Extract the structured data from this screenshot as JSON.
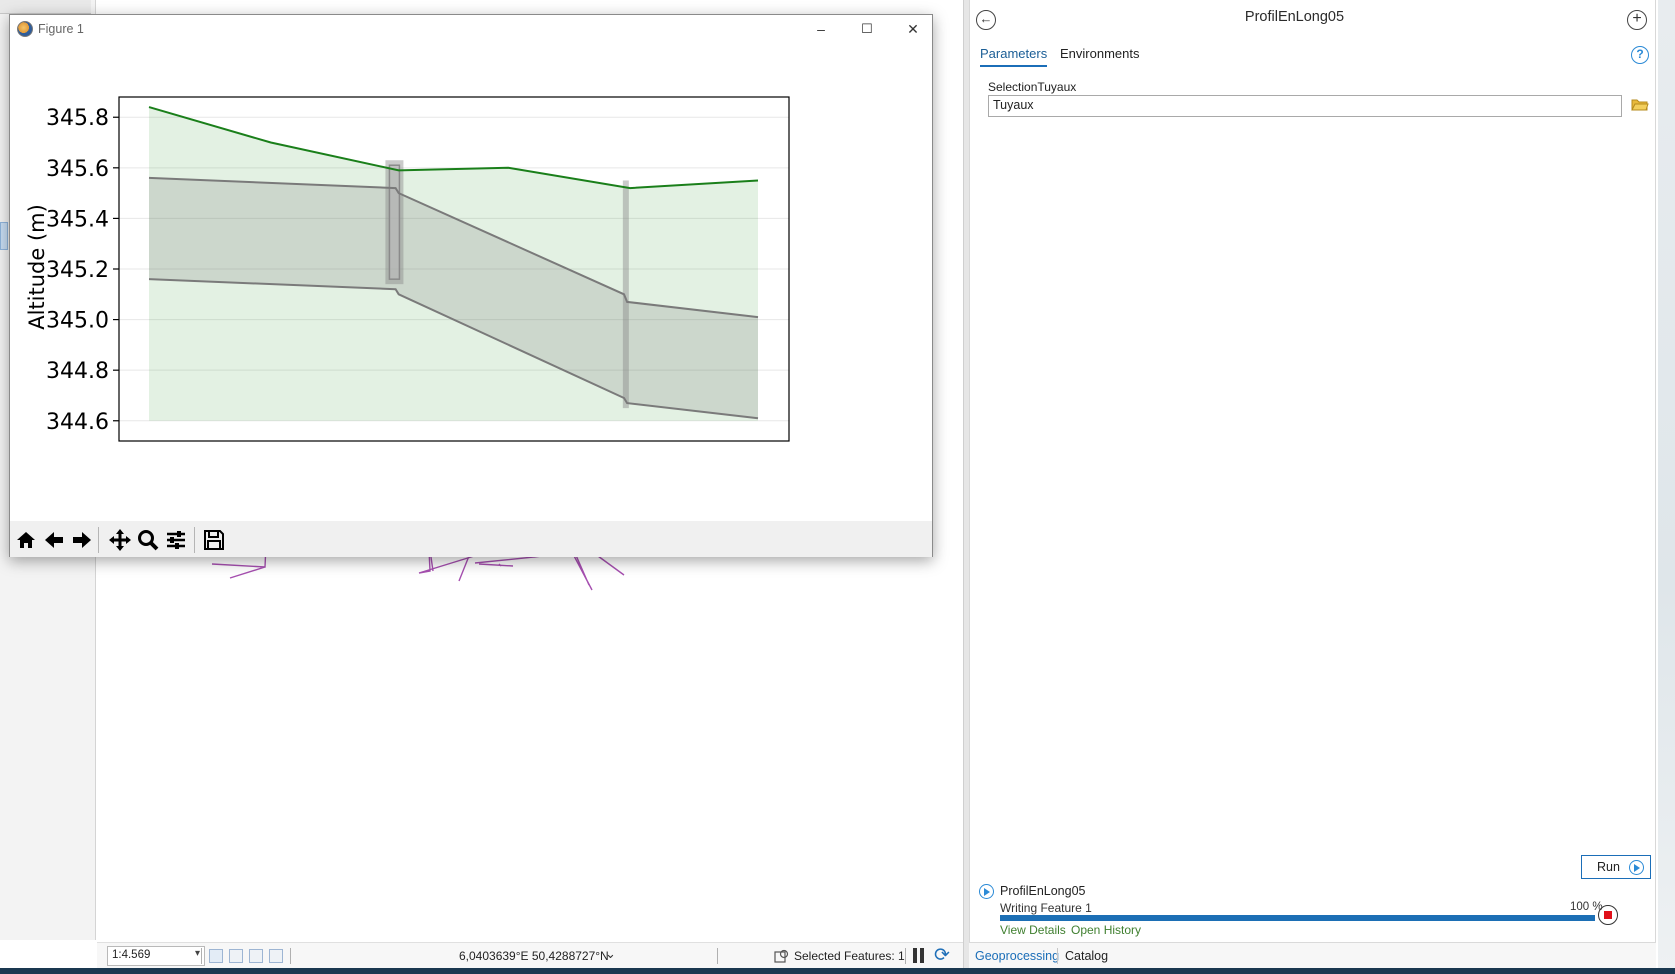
{
  "figure_window": {
    "title": "Figure 1",
    "controls": {
      "minimize": "–",
      "maximize": "☐",
      "close": "✕"
    },
    "toolbar": [
      "home-icon",
      "back-icon",
      "forward-icon",
      "pan-icon",
      "zoom-icon",
      "configure-subplots-icon",
      "save-icon"
    ]
  },
  "chart_data": {
    "type": "area",
    "title": "",
    "xlabel": "",
    "ylabel": "Altitude (m)",
    "x_tick_labels": [],
    "y_ticks": [
      "345.8",
      "345.6",
      "345.4",
      "345.2",
      "345.0",
      "344.8",
      "344.6"
    ],
    "ylim": [
      344.52,
      345.88
    ],
    "grid": true,
    "series": [
      {
        "name": "",
        "kind": "ground-surface",
        "color": "#1a7f1a",
        "points": [
          [
            0,
            345.84
          ],
          [
            0.2,
            345.7
          ],
          [
            0.41,
            345.59
          ],
          [
            0.59,
            345.6
          ],
          [
            0.79,
            345.52
          ],
          [
            1.0,
            345.55
          ]
        ]
      },
      {
        "name": "",
        "kind": "pipe-top",
        "color": "#7a7a7a",
        "points": [
          [
            0,
            345.56
          ],
          [
            0.405,
            345.52
          ],
          [
            0.41,
            345.5
          ],
          [
            0.78,
            345.1
          ],
          [
            0.785,
            345.07
          ],
          [
            1.0,
            345.01
          ]
        ]
      },
      {
        "name": "",
        "kind": "pipe-bottom",
        "color": "#7a7a7a",
        "points": [
          [
            0,
            345.16
          ],
          [
            0.405,
            345.12
          ],
          [
            0.41,
            345.1
          ],
          [
            0.78,
            344.69
          ],
          [
            0.785,
            344.67
          ],
          [
            1.0,
            344.61
          ]
        ]
      }
    ],
    "fill_base": 344.6,
    "manholes": [
      {
        "x": 0.403,
        "top": 345.63,
        "bottom": 345.14
      },
      {
        "x": 0.783,
        "top": 345.55,
        "bottom": 344.65
      }
    ]
  },
  "status_bar": {
    "scale": "1:4.569",
    "coordinates": "6,0403639°E 50,4288727°N",
    "selected_features": "Selected Features: 1"
  },
  "geoprocessing": {
    "title": "ProfilEnLong05",
    "tabs": [
      "Parameters",
      "Environments"
    ],
    "parameter_label": "SelectionTuyaux",
    "parameter_value": "Tuyaux",
    "run_label": "Run",
    "job": {
      "name": "ProfilEnLong05",
      "status": "Writing Feature 1",
      "percent_label": "100 %",
      "progress": 1.0,
      "links": [
        "View Details",
        "Open History"
      ]
    },
    "bottom_tabs": [
      "Geoprocessing",
      "Catalog"
    ]
  }
}
